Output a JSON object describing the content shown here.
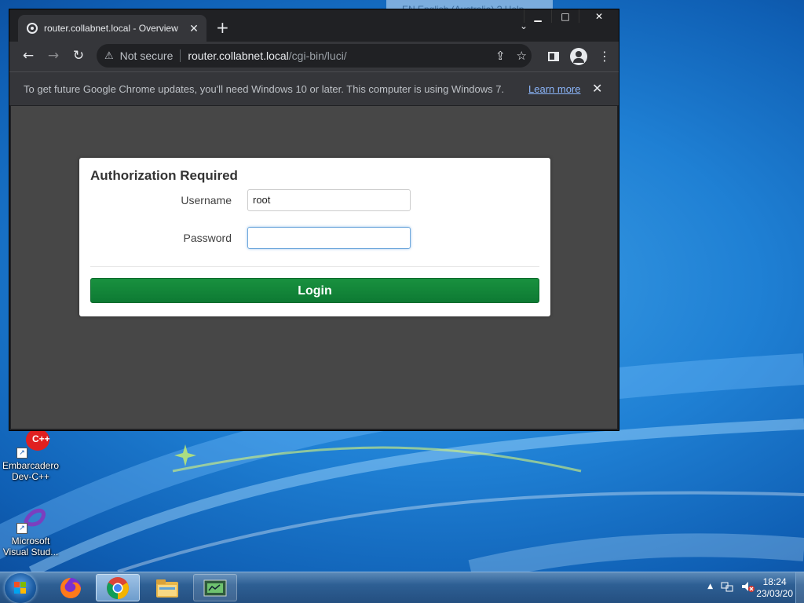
{
  "desktop": {
    "language_bar": "EN English (Australia)   ? Help",
    "icons": [
      {
        "label_line1": "Embarcadero",
        "label_line2": "Dev-C++"
      },
      {
        "label_line1": "Microsoft",
        "label_line2": "Visual Stud..."
      }
    ]
  },
  "browser": {
    "tab": {
      "title": "router.collabnet.local - Overview",
      "close": "✕"
    },
    "new_tab": "+",
    "tab_search": "⌄",
    "window_controls": {
      "minimize": "▁",
      "maximize": "□",
      "close": "✕"
    },
    "toolbar": {
      "back": "←",
      "forward": "→",
      "reload": "↻",
      "security_icon": "⚠",
      "security_text": "Not secure",
      "url_host": "router.collabnet.local",
      "url_path": "/cgi-bin/luci/",
      "share_icon": "⇪",
      "bookmark_icon": "☆",
      "menu_icon": "⋮"
    },
    "infobar": {
      "message": "To get future Google Chrome updates, you'll need Windows 10 or later. This computer is using Windows 7.",
      "link": "Learn more",
      "close": "✕"
    }
  },
  "login": {
    "title": "Authorization Required",
    "username_label": "Username",
    "username_value": "root",
    "password_label": "Password",
    "password_value": "",
    "button_label": "Login"
  },
  "taskbar": {
    "apps": [
      {
        "name": "Firefox",
        "icon": "firefox-icon"
      },
      {
        "name": "Google Chrome",
        "icon": "chrome-icon"
      },
      {
        "name": "Windows Explorer",
        "icon": "folder-icon"
      },
      {
        "name": "Network Tool",
        "icon": "network-tool-icon"
      }
    ],
    "tray_expand": "▲",
    "clock_time": "18:24",
    "clock_date": "23/03/20"
  },
  "colors": {
    "login_button": "#0d7a33",
    "chrome_dark": "#35363a",
    "link": "#8ab4f8"
  }
}
